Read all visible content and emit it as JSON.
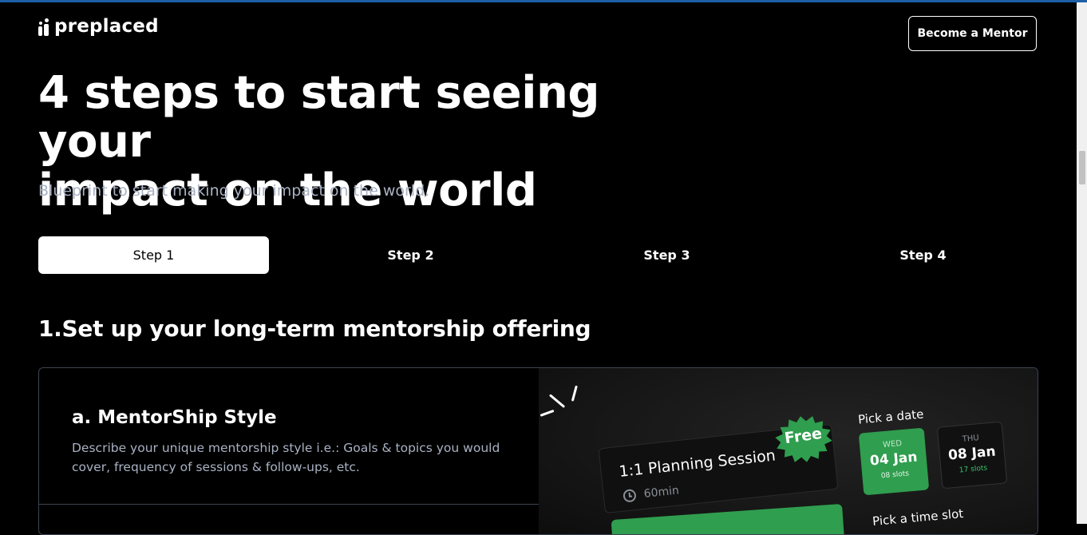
{
  "header": {
    "logo_text": "preplaced",
    "cta_label": "Become a Mentor"
  },
  "hero": {
    "headline_line1": "4 steps to start seeing your",
    "headline_line2": "impact on the world",
    "subtitle": "Blueprint to start making your impact on the world."
  },
  "tabs": [
    {
      "label": "Step 1",
      "active": true
    },
    {
      "label": "Step 2",
      "active": false
    },
    {
      "label": "Step 3",
      "active": false
    },
    {
      "label": "Step 4",
      "active": false
    }
  ],
  "section": {
    "title": "1.Set up your long-term mentorship offering"
  },
  "card": {
    "title": "a. MentorShip Style",
    "description": "Describe your unique mentorship style i.e.: Goals & topics you would cover, frequency of sessions & follow-ups, etc.",
    "preview": {
      "session_title": "1:1 Planning Session",
      "session_duration": "60min",
      "badge": "Free",
      "pick_date_label": "Pick a date",
      "dates": [
        {
          "day": "WED",
          "date": "04 Jan",
          "slots": "08 slots",
          "selected": true
        },
        {
          "day": "THU",
          "date": "08 Jan",
          "slots": "17 slots",
          "selected": false
        }
      ],
      "pick_time_label": "Pick a time slot"
    }
  },
  "colors": {
    "background": "#000000",
    "accent_green": "#2f9e4e",
    "muted_text": "#a9b2c3",
    "border": "#3c4350"
  },
  "icons": [
    "logo-mark-icon",
    "clock-icon",
    "sparkle-lines-icon",
    "starburst-badge-icon"
  ]
}
